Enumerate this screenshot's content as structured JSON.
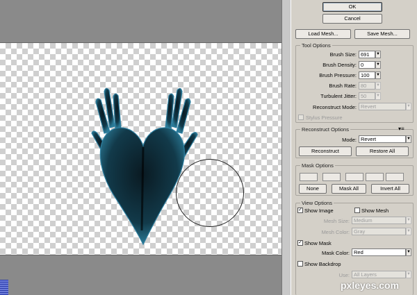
{
  "buttons": {
    "ok": "OK",
    "cancel": "Cancel",
    "load_mesh": "Load Mesh...",
    "save_mesh": "Save Mesh..."
  },
  "tool_options": {
    "title": "Tool Options",
    "brush_size_label": "Brush Size:",
    "brush_size": "691",
    "brush_density_label": "Brush Density:",
    "brush_density": "0",
    "brush_pressure_label": "Brush Pressure:",
    "brush_pressure": "100",
    "brush_rate_label": "Brush Rate:",
    "brush_rate": "80",
    "turbulent_jitter_label": "Turbulent Jitter:",
    "turbulent_jitter": "50",
    "reconstruct_mode_label": "Reconstruct Mode:",
    "reconstruct_mode": "Revert",
    "stylus_pressure": "Stylus Pressure"
  },
  "reconstruct_options": {
    "title": "Reconstruct Options",
    "mode_label": "Mode:",
    "mode": "Revert",
    "reconstruct": "Reconstruct",
    "restore_all": "Restore All"
  },
  "mask_options": {
    "title": "Mask Options",
    "none": "None",
    "mask_all": "Mask All",
    "invert_all": "Invert All"
  },
  "view_options": {
    "title": "View Options",
    "show_image": "Show Image",
    "show_mesh": "Show Mesh",
    "mesh_size_label": "Mesh Size:",
    "mesh_size": "Medium",
    "mesh_color_label": "Mesh Color:",
    "mesh_color": "Gray",
    "show_mask": "Show Mask",
    "mask_color_label": "Mask Color:",
    "mask_color": "Red",
    "show_backdrop": "Show Backdrop",
    "use_label": "Use:",
    "use": "All Layers"
  },
  "watermark": "pxleyes.com",
  "colors": {
    "panel": "#d4d0c8",
    "artwork": "#1f5a70",
    "workspace": "#8a8a8a"
  }
}
